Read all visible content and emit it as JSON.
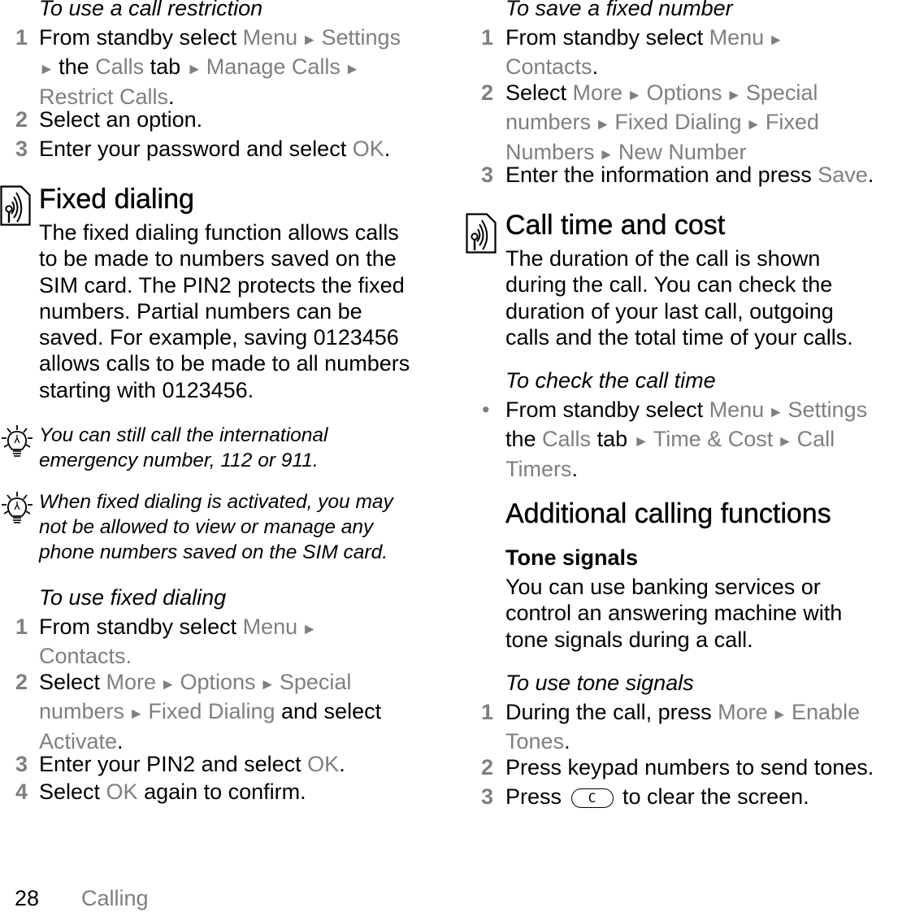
{
  "page": {
    "number": "28",
    "section": "Calling"
  },
  "colors": {
    "text": "#000000",
    "menu_gray": "#7f7f7f"
  },
  "left": {
    "call_restriction": {
      "title": "To use a call restriction",
      "steps": [
        {
          "num": "1",
          "parts": [
            {
              "t": "From standby select "
            },
            {
              "g": "Menu"
            },
            {
              "a": " ► "
            },
            {
              "g": "Settings"
            },
            {
              "br": true
            },
            {
              "a": "► "
            },
            {
              "t": "the "
            },
            {
              "g": "Calls"
            },
            {
              "t": " tab "
            },
            {
              "a": "► "
            },
            {
              "g": "Manage Calls"
            },
            {
              "a": " ►"
            },
            {
              "br": true
            },
            {
              "g": "Restrict Calls"
            },
            {
              "t": "."
            }
          ]
        },
        {
          "num": "2",
          "parts": [
            {
              "t": "Select an option."
            }
          ]
        },
        {
          "num": "3",
          "parts": [
            {
              "t": "Enter your password and select "
            },
            {
              "g": "OK"
            },
            {
              "t": "."
            }
          ]
        }
      ]
    },
    "fixed_dialing": {
      "icon": "network-service-icon",
      "heading": "Fixed dialing",
      "body_lines": [
        "The fixed dialing function allows calls",
        "to be made to numbers saved on the",
        "SIM card. The PIN2 protects the fixed",
        "numbers. Partial numbers can be",
        "saved. For example, saving 0123456",
        "allows calls to be made to all numbers",
        "starting with 0123456."
      ],
      "tips": [
        {
          "icon": "lightbulb-tip-icon",
          "lines": [
            "You can still call the international",
            "emergency number, 112 or 911."
          ]
        },
        {
          "icon": "lightbulb-tip-icon",
          "lines": [
            "When fixed dialing is activated, you may",
            "not be allowed to view or manage any",
            "phone numbers saved on the SIM card."
          ]
        }
      ]
    },
    "use_fixed_dialing": {
      "title": "To use fixed dialing",
      "steps": [
        {
          "num": "1",
          "parts": [
            {
              "t": "From standby select "
            },
            {
              "g": "Menu"
            },
            {
              "a": " ►"
            },
            {
              "br": true
            },
            {
              "g": "Contacts."
            }
          ]
        },
        {
          "num": "2",
          "parts": [
            {
              "t": "Select "
            },
            {
              "g": "More"
            },
            {
              "a": " ► "
            },
            {
              "g": "Options"
            },
            {
              "a": " ► "
            },
            {
              "g": "Special"
            },
            {
              "br": true
            },
            {
              "g": "numbers"
            },
            {
              "a": " ► "
            },
            {
              "g": "Fixed Dialing"
            },
            {
              "t": " and select"
            },
            {
              "br": true
            },
            {
              "g": "Activate"
            },
            {
              "t": "."
            }
          ]
        },
        {
          "num": "3",
          "parts": [
            {
              "t": "Enter your PIN2 and select "
            },
            {
              "g": "OK"
            },
            {
              "t": "."
            }
          ]
        },
        {
          "num": "4",
          "parts": [
            {
              "t": "Select "
            },
            {
              "g": "OK"
            },
            {
              "t": " again to confirm."
            }
          ]
        }
      ]
    }
  },
  "right": {
    "save_fixed_number": {
      "title": "To save a fixed number",
      "steps": [
        {
          "num": "1",
          "parts": [
            {
              "t": "From standby select "
            },
            {
              "g": "Menu"
            },
            {
              "a": " ►"
            },
            {
              "br": true
            },
            {
              "g": "Contacts"
            },
            {
              "t": "."
            }
          ]
        },
        {
          "num": "2",
          "parts": [
            {
              "t": "Select "
            },
            {
              "g": "More"
            },
            {
              "a": " ► "
            },
            {
              "g": "Options"
            },
            {
              "a": " ► "
            },
            {
              "g": "Special"
            },
            {
              "br": true
            },
            {
              "g": "numbers"
            },
            {
              "a": " ► "
            },
            {
              "g": "Fixed Dialing"
            },
            {
              "a": " ► "
            },
            {
              "g": "Fixed"
            },
            {
              "br": true
            },
            {
              "g": "Numbers"
            },
            {
              "a": " ► "
            },
            {
              "g": "New Number"
            }
          ]
        },
        {
          "num": "3",
          "parts": [
            {
              "t": "Enter the information and press "
            },
            {
              "g": "Save"
            },
            {
              "t": "."
            }
          ]
        }
      ]
    },
    "call_time_cost": {
      "icon": "network-service-icon",
      "heading": "Call time and cost",
      "body_lines": [
        "The duration of the call is shown",
        "during the call. You can check the",
        "duration of your last call, outgoing",
        "calls and the total time of your calls."
      ]
    },
    "check_call_time": {
      "title": "To check the call time",
      "bullet": "•",
      "parts": [
        {
          "t": "From standby select "
        },
        {
          "g": "Menu"
        },
        {
          "a": " ► "
        },
        {
          "g": "Settings"
        },
        {
          "br": true
        },
        {
          "t": "the "
        },
        {
          "g": "Calls"
        },
        {
          "t": " tab "
        },
        {
          "a": "► "
        },
        {
          "g": "Time & Cost"
        },
        {
          "a": " ► "
        },
        {
          "g": "Call"
        },
        {
          "br": true
        },
        {
          "g": "Timers"
        },
        {
          "t": "."
        }
      ]
    },
    "additional": {
      "heading": "Additional calling functions",
      "subheading": "Tone signals",
      "body_lines": [
        "You can use banking services or",
        "control an answering machine with",
        "tone signals during a call."
      ]
    },
    "use_tone_signals": {
      "title": "To use tone signals",
      "steps": [
        {
          "num": "1",
          "parts": [
            {
              "t": "During the call, press "
            },
            {
              "g": "More"
            },
            {
              "a": " ► "
            },
            {
              "g": "Enable"
            },
            {
              "br": true
            },
            {
              "g": "Tones"
            },
            {
              "t": "."
            }
          ]
        },
        {
          "num": "2",
          "parts": [
            {
              "t": "Press keypad numbers to send tones."
            }
          ]
        },
        {
          "num": "3",
          "parts": [
            {
              "t": "Press "
            },
            {
              "key": "C"
            },
            {
              "t": " to clear the screen."
            }
          ]
        }
      ]
    }
  }
}
